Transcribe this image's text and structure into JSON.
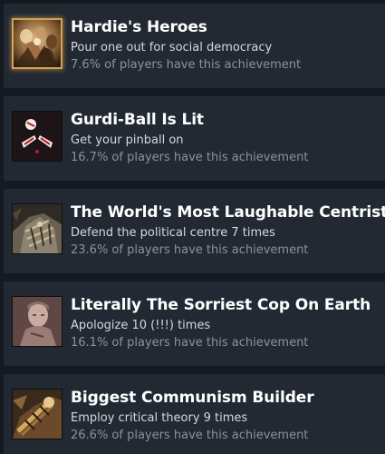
{
  "achievements": [
    {
      "title": "Hardie's Heroes",
      "description": "Pour one out for social democracy",
      "percent_text": "7.6% of players have this achievement",
      "icon": "heroes-crowd-icon",
      "highlighted": true
    },
    {
      "title": "Gurdi-Ball Is Lit",
      "description": "Get your pinball on",
      "percent_text": "16.7% of players have this achievement",
      "icon": "pinball-icon",
      "highlighted": false
    },
    {
      "title": "The World's Most Laughable Centrist",
      "description": "Defend the political centre 7 times",
      "percent_text": "23.6% of players have this achievement",
      "icon": "centrist-portrait-icon",
      "highlighted": false
    },
    {
      "title": "Literally The Sorriest Cop On Earth",
      "description": "Apologize 10 (!!!) times",
      "percent_text": "16.1% of players have this achievement",
      "icon": "cop-portrait-icon",
      "highlighted": false
    },
    {
      "title": "Biggest Communism Builder",
      "description": "Employ critical theory 9 times",
      "percent_text": "26.6% of players have this achievement",
      "icon": "communism-builder-icon",
      "highlighted": false
    }
  ],
  "colors": {
    "page_background": "#151a22",
    "row_background": "#222933",
    "title": "#ffffff",
    "description": "#d6d8db",
    "percent": "#8b929a",
    "highlight_border": "#d3a350"
  }
}
